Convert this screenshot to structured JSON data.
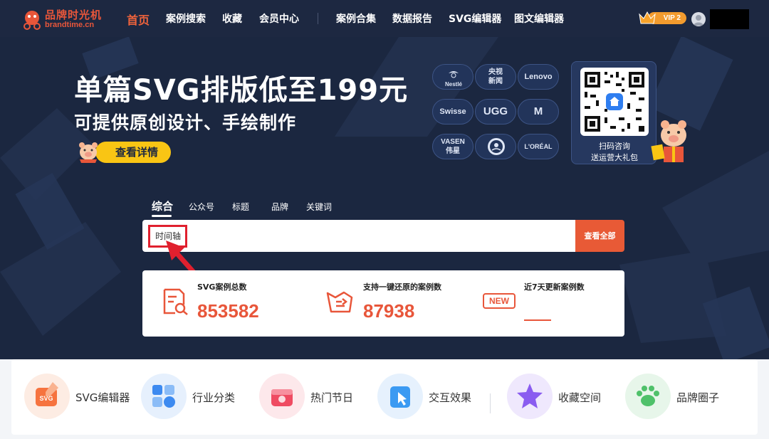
{
  "app": {
    "logo_cn": "品牌时光机",
    "logo_en": "brandtime.cn",
    "colors": {
      "nav_bg": "#1d2841",
      "accent": "#e8563a",
      "yellow": "#f9c514",
      "hero_bg": "#1b2740"
    }
  },
  "nav": {
    "items": [
      {
        "label": "首页",
        "active": true
      },
      {
        "label": "案例搜索"
      },
      {
        "label": "收藏"
      },
      {
        "label": "会员中心"
      },
      {
        "label": "案例合集"
      },
      {
        "label": "数据报告"
      },
      {
        "label": "SVG编辑器"
      },
      {
        "label": "图文编辑器"
      }
    ],
    "vip_label": "VIP 2"
  },
  "hero": {
    "headline": "单篇SVG排版低至199元",
    "subline": "可提供原创设计、手绘制作",
    "detail_button": "查看详情",
    "brands": [
      {
        "text": "Nestlé",
        "icon": "nestle-logo"
      },
      {
        "text": "央视 新闻",
        "line1": "央视",
        "line2": "新闻"
      },
      {
        "text": "Lenovo"
      },
      {
        "text": "Swisse"
      },
      {
        "text": "UGG"
      },
      {
        "text": "M"
      },
      {
        "text": "VASEN 伟星",
        "line1": "VASEN",
        "line2": "伟星"
      },
      {
        "text": "",
        "icon": "starbucks-logo"
      },
      {
        "text": "L'ORÉAL"
      }
    ],
    "qr_line1": "扫码咨询",
    "qr_line2": "送运营大礼包"
  },
  "search": {
    "tabs": [
      "综合",
      "公众号",
      "标题",
      "品牌",
      "关键词"
    ],
    "active_tab": "综合",
    "query": "时间轴",
    "button": "查看全部"
  },
  "stats": [
    {
      "label": "SVG案例总数",
      "value": "853582",
      "icon": "search-document-icon"
    },
    {
      "label": "支持一键还原的案例数",
      "value": "87938",
      "icon": "restore-icon"
    },
    {
      "label": "近7天更新案例数",
      "value": "",
      "icon": "new-badge-icon",
      "badge": "NEW"
    }
  ],
  "categories": [
    {
      "label": "SVG编辑器",
      "icon": "svg-editor-icon",
      "color": "#f6733f"
    },
    {
      "label": "行业分类",
      "icon": "industry-icon",
      "color": "#3d8af0"
    },
    {
      "label": "热门节日",
      "icon": "festival-icon",
      "color": "#ef4b62"
    },
    {
      "label": "交互效果",
      "icon": "interaction-icon",
      "color": "#3b9af2"
    },
    {
      "label": "收藏空间",
      "icon": "star-collection-icon",
      "color": "#8a5cf0"
    },
    {
      "label": "品牌圈子",
      "icon": "paw-icon",
      "color": "#4fc16a"
    }
  ]
}
